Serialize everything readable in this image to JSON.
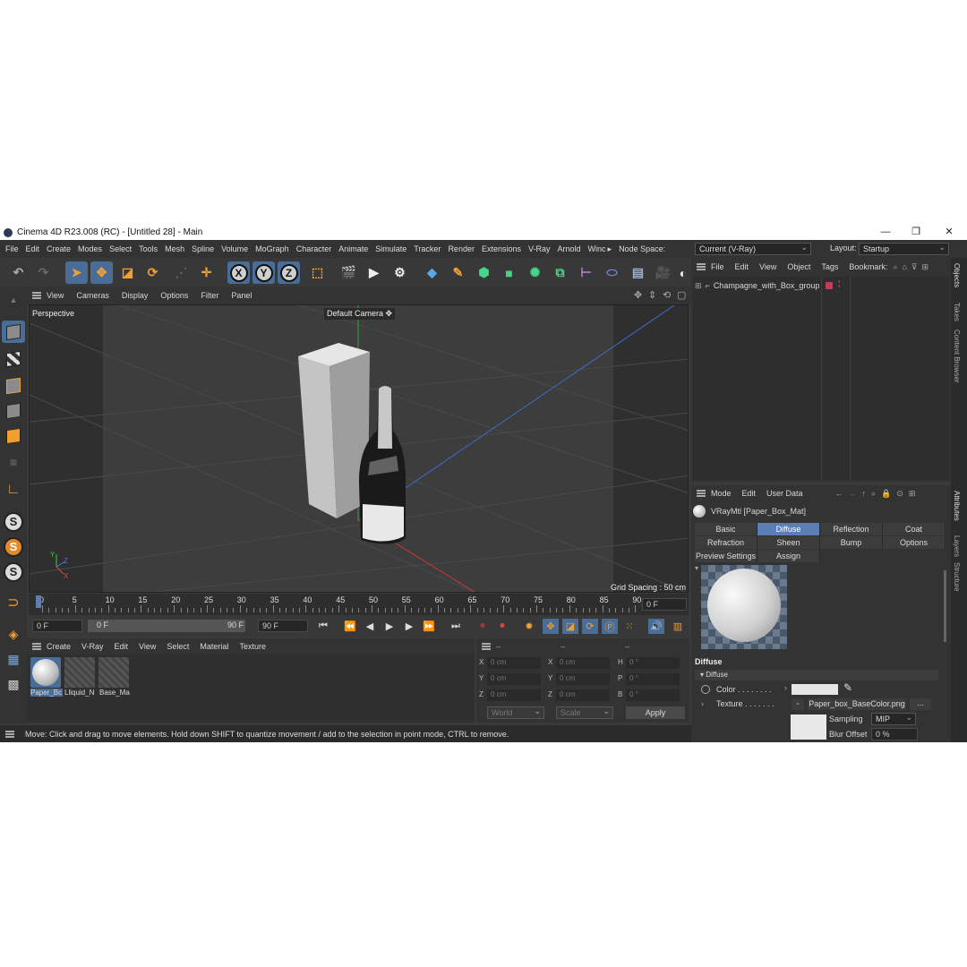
{
  "window": {
    "title": "Cinema 4D R23.008 (RC) - [Untitled 28] - Main",
    "minimize": "—",
    "restore": "❐",
    "close": "✕"
  },
  "menu": {
    "items": [
      "File",
      "Edit",
      "Create",
      "Modes",
      "Select",
      "Tools",
      "Mesh",
      "Spline",
      "Volume",
      "MoGraph",
      "Character",
      "Animate",
      "Simulate",
      "Tracker",
      "Render",
      "Extensions",
      "V-Ray",
      "Arnold",
      "Winc"
    ],
    "more": "▸",
    "node_space_label": "Node Space:",
    "node_space_value": "Current (V-Ray)",
    "layout_label": "Layout:",
    "layout_value": "Startup"
  },
  "toolbar": {
    "axis_x": "X",
    "axis_y": "Y",
    "axis_z": "Z"
  },
  "viewport": {
    "menu": [
      "View",
      "Cameras",
      "Display",
      "Options",
      "Filter",
      "Panel"
    ],
    "label": "Perspective",
    "camera": "Default Camera",
    "camera_icon": "✥",
    "grid_spacing": "Grid Spacing : 50 cm",
    "axis_y": "Y",
    "axis_z": "Z",
    "axis_x": "X"
  },
  "timeline": {
    "ticks": [
      "0",
      "5",
      "10",
      "15",
      "20",
      "25",
      "30",
      "35",
      "40",
      "45",
      "50",
      "55",
      "60",
      "65",
      "70",
      "75",
      "80",
      "85",
      "90"
    ],
    "current_frame": "0 F"
  },
  "transport": {
    "start": "0 F",
    "range_start": "0 F",
    "range_end": "90 F",
    "end": "90 F"
  },
  "materials": {
    "menu": [
      "Create",
      "V-Ray",
      "Edit",
      "View",
      "Select",
      "Material",
      "Texture"
    ],
    "items": [
      {
        "label": "Paper_Bc",
        "type": "sphere",
        "selected": true
      },
      {
        "label": "Lliquid_N",
        "type": "striped",
        "selected": false
      },
      {
        "label": "Base_Ma",
        "type": "striped",
        "selected": false
      }
    ]
  },
  "coords": {
    "header": [
      "--",
      "--",
      "--"
    ],
    "rows": [
      {
        "a": "X",
        "av": "0 cm",
        "b": "X",
        "bv": "0 cm",
        "c": "H",
        "cv": "0 °"
      },
      {
        "a": "Y",
        "av": "0 cm",
        "b": "Y",
        "bv": "0 cm",
        "c": "P",
        "cv": "0 °"
      },
      {
        "a": "Z",
        "av": "0 cm",
        "b": "Z",
        "bv": "0 cm",
        "c": "B",
        "cv": "0 °"
      }
    ],
    "world": "World",
    "scale": "Scale",
    "apply": "Apply"
  },
  "status": "Move: Click and drag to move elements. Hold down SHIFT to quantize movement / add to the selection in point mode, CTRL to remove.",
  "objects": {
    "menu": [
      "File",
      "Edit",
      "View",
      "Object",
      "Tags",
      "Bookmark:"
    ],
    "items": [
      {
        "name": "Champagne_with_Box_group",
        "expand": "⊞"
      }
    ]
  },
  "attributes": {
    "menu": [
      "Mode",
      "Edit",
      "User Data"
    ],
    "material_name": "VRayMtl [Paper_Box_Mat]",
    "tabs_row1": [
      "Basic",
      "Diffuse",
      "Reflection",
      "Coat"
    ],
    "tabs_row2": [
      "Refraction",
      "Sheen",
      "Bump",
      "Options"
    ],
    "tabs_row3": [
      "Preview Settings",
      "Assign"
    ],
    "active_tab": "Diffuse",
    "section": "Diffuse",
    "subsection": "▾ Diffuse",
    "color_label": "Color . . . . . . . .",
    "texture_label": "Texture . . . . . . .",
    "texture_file": "Paper_box_BaseColor.png",
    "texture_more": "...",
    "sampling_label": "Sampling",
    "sampling_value": "MIP",
    "blur_label": "Blur Offset",
    "blur_value": "0 %"
  },
  "side_tabs": [
    "Objects",
    "Takes",
    "Content Browser",
    "Attributes",
    "Layers",
    "Structure"
  ]
}
